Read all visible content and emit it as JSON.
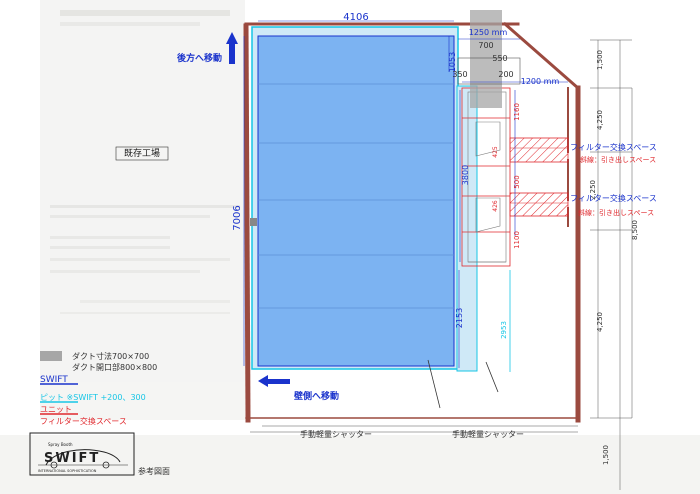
{
  "labels": {
    "existing_factory": "既存工場",
    "move_back": "後方へ移動",
    "move_wall": "壁側へ移動",
    "filter_space_1": "フィルター交換スペース",
    "pullout_space_1": "斜線：引き出しスペース",
    "filter_space_2": "フィルター交換スペース",
    "pullout_space_2": "斜線：引き出しスペース",
    "shutter_left": "手動軽量シャッター",
    "shutter_right": "手動軽量シャッター",
    "reference": "参考図面"
  },
  "dimensions": {
    "top_width": "4106",
    "left_height": "7006",
    "d1250": "1250 mm",
    "d700": "700",
    "d550": "550",
    "d1053": "1053",
    "d350": "350",
    "d200": "200",
    "d1200": "1200 mm",
    "d3800": "3800",
    "d2153": "2153",
    "d2953": "2953",
    "d1160": "1160",
    "d1100": "1100",
    "d500": "500",
    "d425": "425",
    "d426": "426",
    "r1500_top": "1,500",
    "r4250_a": "4,250",
    "r2250": "2,250",
    "r8500": "8,500",
    "r4250_b": "4,250",
    "r1500_bottom": "1,500"
  },
  "legend": {
    "duct_size": "ダクト寸法700×700",
    "duct_opening": "ダクト開口部800×800",
    "swift": "SWIFT",
    "pit": "ピット ※SWIFT +200、300",
    "unit": "ユニット",
    "unit_filter": "フィルター交換スペース"
  },
  "logo": {
    "sub": "Spray Booth",
    "name": "SWIFT",
    "tagline": "INTERNATIONAL SOPHISTICATION"
  },
  "colors": {
    "wall": "#9b4a3f",
    "swift_blue": "#1a33cc",
    "pit_cyan": "#17c6e6",
    "unit_red": "#e0282d",
    "duct_gray": "#a6a6a6",
    "booth_fill": "#7cb3f2"
  }
}
